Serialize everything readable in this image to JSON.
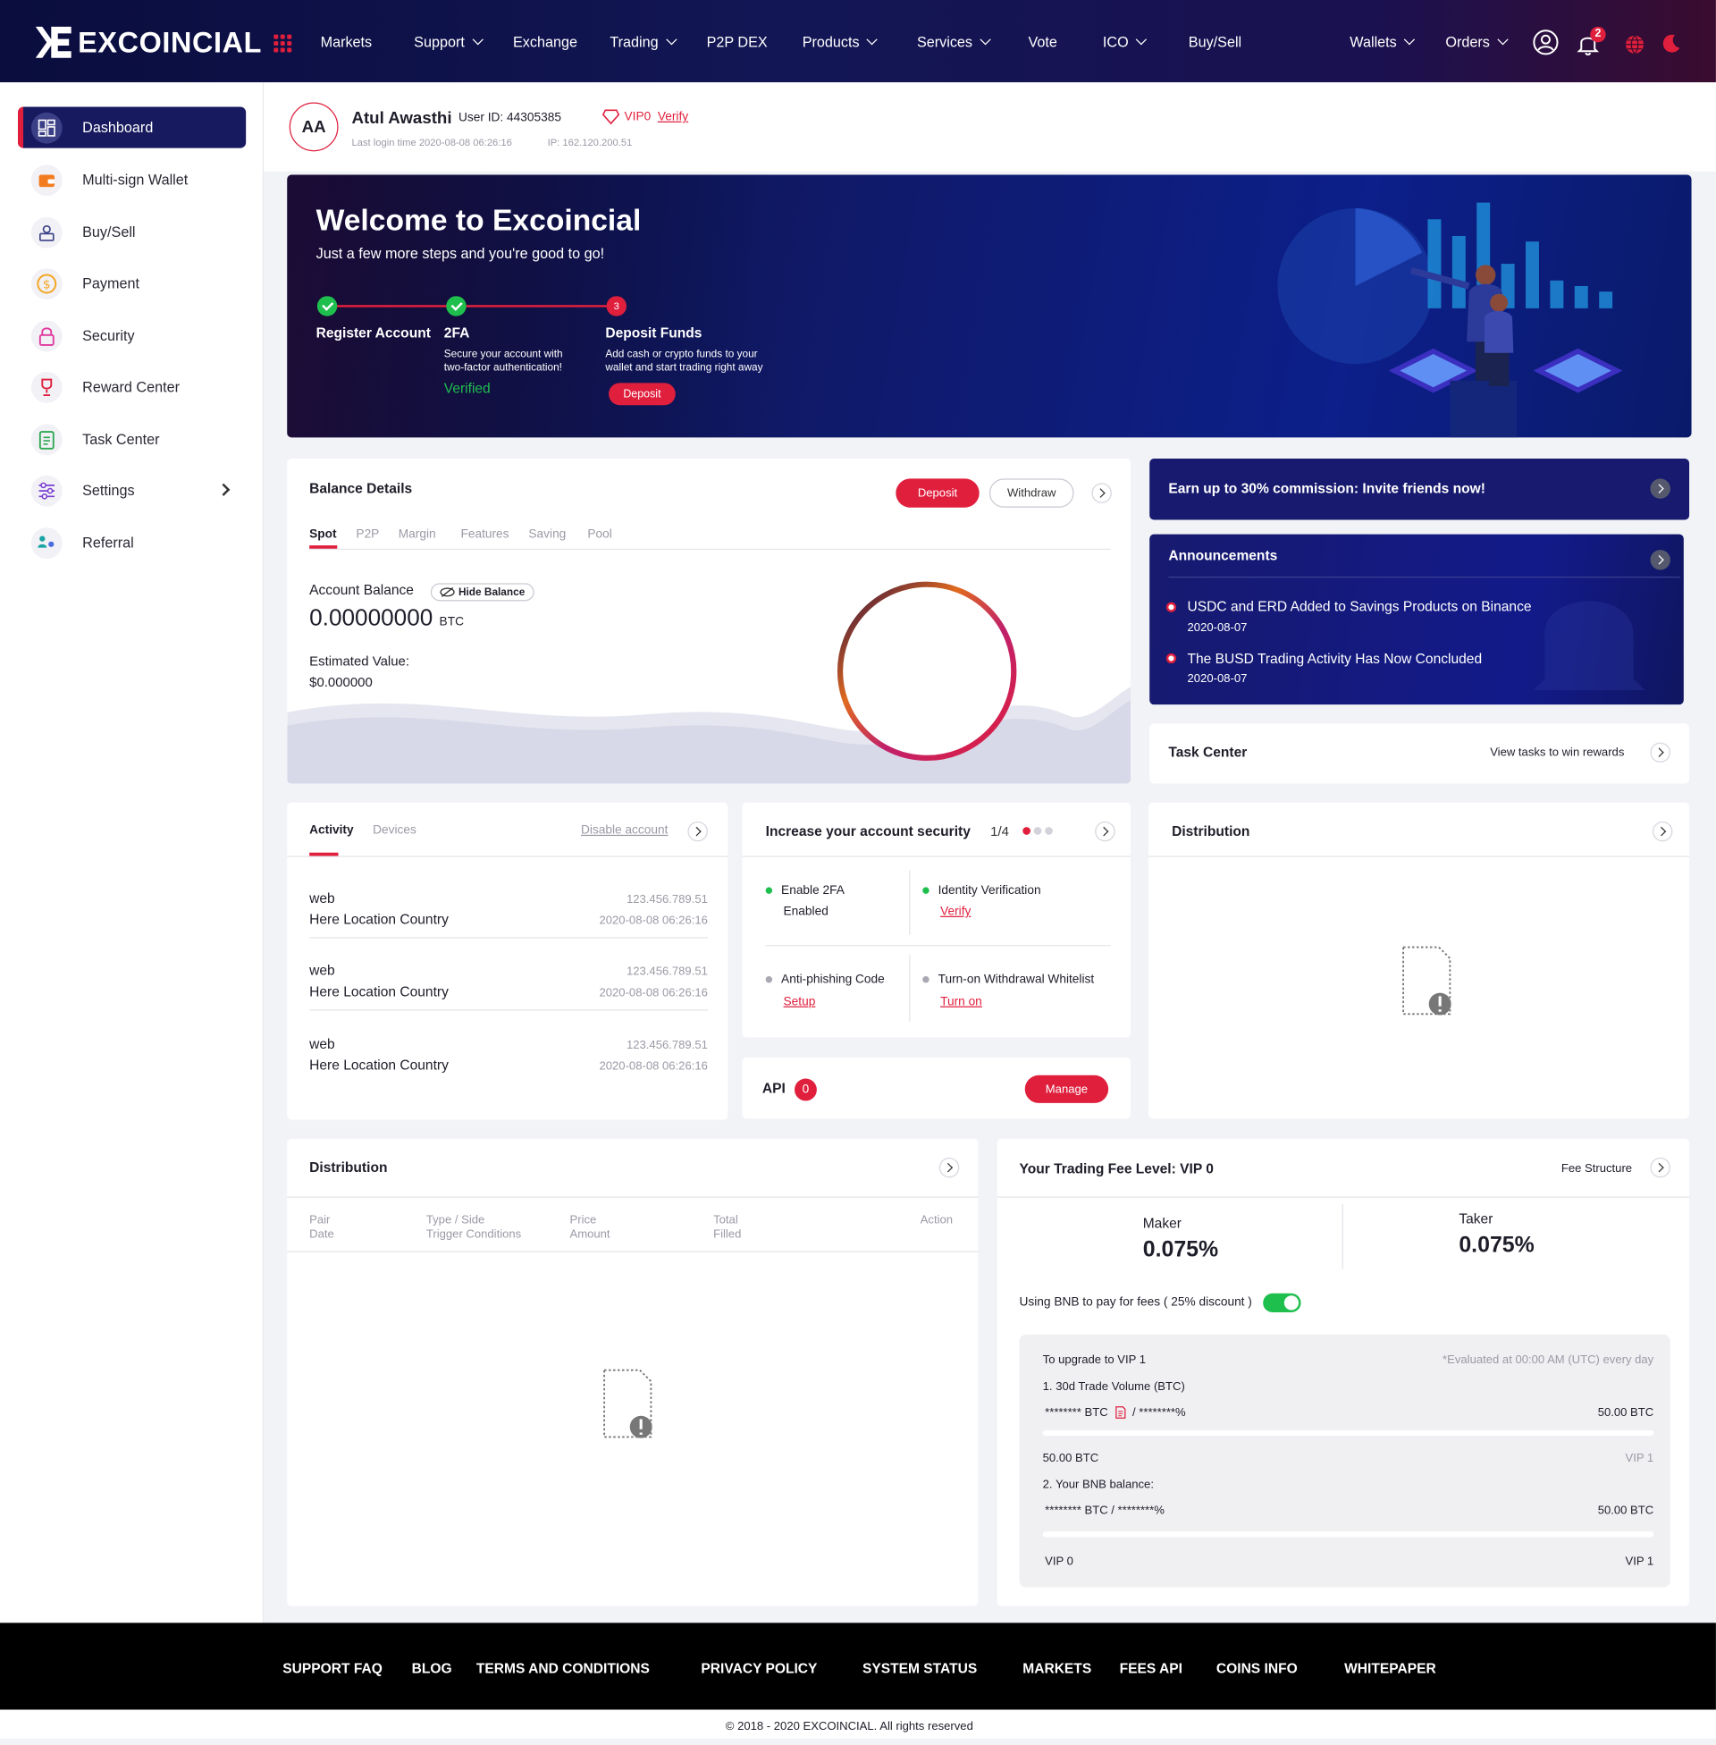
{
  "brand": {
    "name": "EXCOINCIAL"
  },
  "nav": [
    {
      "label": "Markets",
      "dropdown": false
    },
    {
      "label": "Support",
      "dropdown": true
    },
    {
      "label": "Exchange",
      "dropdown": false
    },
    {
      "label": "Trading",
      "dropdown": true
    },
    {
      "label": "P2P DEX",
      "dropdown": false
    },
    {
      "label": "Products",
      "dropdown": true
    },
    {
      "label": "Services",
      "dropdown": true
    },
    {
      "label": "Vote",
      "dropdown": false
    },
    {
      "label": "ICO",
      "dropdown": true
    },
    {
      "label": "Buy/Sell",
      "dropdown": false
    }
  ],
  "nav_right": {
    "wallets": "Wallets",
    "orders": "Orders",
    "notification_count": "2"
  },
  "sidebar": {
    "items": [
      {
        "label": "Dashboard",
        "icon": "dashboard-icon"
      },
      {
        "label": "Multi-sign Wallet",
        "icon": "wallet-icon"
      },
      {
        "label": "Buy/Sell",
        "icon": "buy-sell-icon"
      },
      {
        "label": "Payment",
        "icon": "dollar-coin-icon"
      },
      {
        "label": "Security",
        "icon": "lock-icon"
      },
      {
        "label": "Reward Center",
        "icon": "trophy-icon"
      },
      {
        "label": "Task Center",
        "icon": "clipboard-icon"
      },
      {
        "label": "Settings",
        "icon": "sliders-icon"
      },
      {
        "label": "Referral",
        "icon": "people-icon"
      }
    ]
  },
  "profile": {
    "initials": "AA",
    "name": "Atul Awasthi",
    "user_id": "User ID: 44305385",
    "vip": "VIP0",
    "verify": "Verify",
    "last_login": "Last login time 2020-08-08 06:26:16",
    "ip": "IP: 162.120.200.51"
  },
  "banner": {
    "title": "Welcome to Excoincial",
    "subtitle": "Just a few more steps and you're good to go!",
    "step1": {
      "title": "Register Account"
    },
    "step2": {
      "title": "2FA",
      "desc1": "Secure your account with",
      "desc2": "two-factor authentication!",
      "status": "Verified"
    },
    "step3": {
      "num": "3",
      "title": "Deposit Funds",
      "desc1": "Add cash or crypto funds to your",
      "desc2": "wallet and start trading right away",
      "button": "Deposit"
    }
  },
  "balance": {
    "title": "Balance Details",
    "deposit": "Deposit",
    "withdraw": "Withdraw",
    "tabs": [
      "Spot",
      "P2P",
      "Margin",
      "Features",
      "Saving",
      "Pool"
    ],
    "account_label": "Account Balance",
    "hide": "Hide Balance",
    "amount": "0.00000000",
    "unit": "BTC",
    "estimated_label": "Estimated Value:",
    "estimated": "$0.000000"
  },
  "invite": {
    "text": "Earn up to 30% commission: Invite friends now!"
  },
  "announcements": {
    "title": "Announcements",
    "items": [
      {
        "title": "USDC and ERD Added to Savings Products on Binance",
        "date": "2020-08-07"
      },
      {
        "title": "The BUSD Trading Activity Has Now Concluded",
        "date": "2020-08-07"
      }
    ]
  },
  "task": {
    "title": "Task Center",
    "link": "View tasks to win rewards"
  },
  "activity": {
    "tabs": [
      "Activity",
      "Devices"
    ],
    "disable": "Disable account",
    "rows": [
      {
        "type": "web",
        "location": "Here Location Country",
        "ip": "123.456.789.51",
        "time": "2020-08-08 06:26:16"
      },
      {
        "type": "web",
        "location": "Here Location Country",
        "ip": "123.456.789.51",
        "time": "2020-08-08 06:26:16"
      },
      {
        "type": "web",
        "location": "Here Location Country",
        "ip": "123.456.789.51",
        "time": "2020-08-08 06:26:16"
      }
    ]
  },
  "security": {
    "title": "Increase your account security",
    "progress": "1/4",
    "items": [
      {
        "label": "Enable 2FA",
        "value": "Enabled",
        "status": "done"
      },
      {
        "label": "Identity Verification",
        "value": "Verify",
        "status": "done"
      },
      {
        "label": "Anti-phishing Code",
        "value": "Setup",
        "status": "pending"
      },
      {
        "label": "Turn-on Withdrawal Whitelist",
        "value": "Turn on",
        "status": "pending"
      }
    ]
  },
  "api": {
    "label": "API",
    "count": "0",
    "button": "Manage"
  },
  "distribution_right": {
    "title": "Distribution"
  },
  "distribution": {
    "title": "Distribution",
    "columns": [
      {
        "top": "Pair",
        "bottom": "Date"
      },
      {
        "top": "Type / Side",
        "bottom": "Trigger Conditions"
      },
      {
        "top": "Price",
        "bottom": "Amount"
      },
      {
        "top": "Total",
        "bottom": "Filled"
      },
      {
        "top": "Action",
        "bottom": ""
      }
    ]
  },
  "fee": {
    "title": "Your Trading Fee Level: VIP 0",
    "structure": "Fee Structure",
    "maker_label": "Maker",
    "maker": "0.075%",
    "taker_label": "Taker",
    "taker": "0.075%",
    "bnb": "Using BNB to pay for fees ( 25% discount )",
    "bnb_enabled": true,
    "upgrade": "To upgrade to VIP 1",
    "evaluated": "*Evaluated at 00:00 AM (UTC) every day",
    "volume_label": "1. 30d Trade Volume (BTC)",
    "volume_masked": "******** BTC",
    "volume_pct": "/ ********%",
    "volume_target": "50.00 BTC",
    "volume_from": "50.00 BTC",
    "volume_to": "VIP 1",
    "bnb_label": "2. Your BNB balance:",
    "bnb_masked": "******** BTC  / ********%",
    "bnb_target": "50.00 BTC",
    "bnb_from": "VIP 0",
    "bnb_to": "VIP 1"
  },
  "footer": {
    "links": [
      "SUPPORT FAQ",
      "BLOG",
      "TERMS AND CONDITIONS",
      "PRIVACY POLICY",
      "SYSTEM STATUS",
      "MARKETS",
      "FEES API",
      "COINS INFO",
      "WHITEPAPER"
    ],
    "copyright": "© 2018 - 2020 EXCOINCIAL. All rights reserved"
  },
  "colors": {
    "accent": "#e01f3d",
    "navy": "#171a5e",
    "green": "#1fbf4e"
  }
}
